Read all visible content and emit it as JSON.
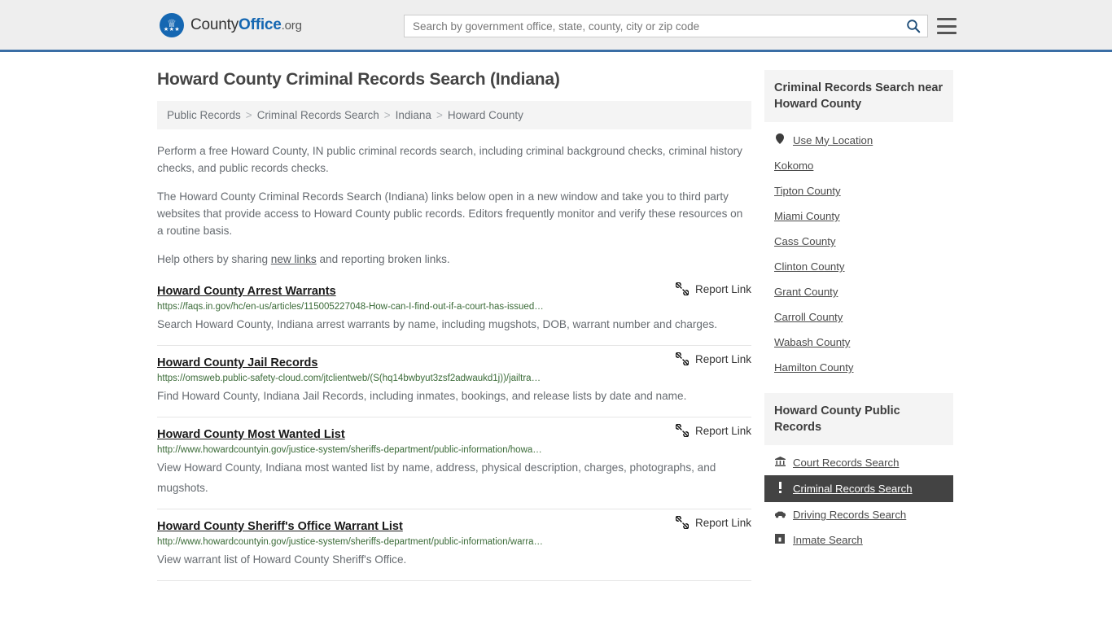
{
  "header": {
    "brand": {
      "part1": "County",
      "part2": "Office",
      "part3": ".org",
      "logo_icon": "eagle-shield-icon"
    },
    "search": {
      "placeholder": "Search by government office, state, county, city or zip code",
      "value": "",
      "search_icon": "search-icon"
    },
    "menu_icon": "hamburger-menu-icon"
  },
  "page": {
    "title": "Howard County Criminal Records Search (Indiana)",
    "breadcrumb": [
      {
        "label": "Public Records"
      },
      {
        "label": "Criminal Records Search"
      },
      {
        "label": "Indiana"
      },
      {
        "label": "Howard County"
      }
    ],
    "breadcrumb_separator": ">",
    "intro_paragraphs": [
      "Perform a free Howard County, IN public criminal records search, including criminal background checks, criminal history checks, and public records checks.",
      "The Howard County Criminal Records Search (Indiana) links below open in a new window and take you to third party websites that provide access to Howard County public records. Editors frequently monitor and verify these resources on a routine basis."
    ],
    "share_line": {
      "before": "Help others by sharing ",
      "link": "new links",
      "after": " and reporting broken links."
    }
  },
  "results": {
    "report_label": "Report Link",
    "report_icon": "broken-link-icon",
    "items": [
      {
        "title": "Howard County Arrest Warrants",
        "url": "https://faqs.in.gov/hc/en-us/articles/115005227048-How-can-I-find-out-if-a-court-has-issued…",
        "description": "Search Howard County, Indiana arrest warrants by name, including mugshots, DOB, warrant number and charges."
      },
      {
        "title": "Howard County Jail Records",
        "url": "https://omsweb.public-safety-cloud.com/jtclientweb/(S(hq14bwbyut3zsf2adwaukd1j))/jailtra…",
        "description": "Find Howard County, Indiana Jail Records, including inmates, bookings, and release lists by date and name."
      },
      {
        "title": "Howard County Most Wanted List",
        "url": "http://www.howardcountyin.gov/justice-system/sheriffs-department/public-information/howa…",
        "description": "View Howard County, Indiana most wanted list by name, address, physical description, charges, photographs, and mugshots."
      },
      {
        "title": "Howard County Sheriff's Office Warrant List",
        "url": "http://www.howardcountyin.gov/justice-system/sheriffs-department/public-information/warra…",
        "description": "View warrant list of Howard County Sheriff's Office."
      }
    ]
  },
  "sidebar": {
    "nearby": {
      "heading": "Criminal Records Search near Howard County",
      "items": [
        {
          "label": "Use My Location",
          "icon": "map-pin-icon"
        },
        {
          "label": "Kokomo",
          "icon": ""
        },
        {
          "label": "Tipton County",
          "icon": ""
        },
        {
          "label": "Miami County",
          "icon": ""
        },
        {
          "label": "Cass County",
          "icon": ""
        },
        {
          "label": "Clinton County",
          "icon": ""
        },
        {
          "label": "Grant County",
          "icon": ""
        },
        {
          "label": "Carroll County",
          "icon": ""
        },
        {
          "label": "Wabash County",
          "icon": ""
        },
        {
          "label": "Hamilton County",
          "icon": ""
        }
      ]
    },
    "public_records": {
      "heading": "Howard County Public Records",
      "items": [
        {
          "label": "Court Records Search",
          "icon": "courthouse-icon",
          "glyph": "🏛",
          "active": false
        },
        {
          "label": "Criminal Records Search",
          "icon": "exclamation-icon",
          "glyph": "❗",
          "active": true
        },
        {
          "label": "Driving Records Search",
          "icon": "car-icon",
          "glyph": "🚗",
          "active": false
        },
        {
          "label": "Inmate Search",
          "icon": "jail-icon",
          "glyph": "🔒",
          "active": false
        }
      ]
    }
  },
  "colors": {
    "brand_blue": "#1567b2",
    "header_border": "#3a6ea5",
    "url_green": "#3b6b38",
    "active_bg": "#434343"
  }
}
